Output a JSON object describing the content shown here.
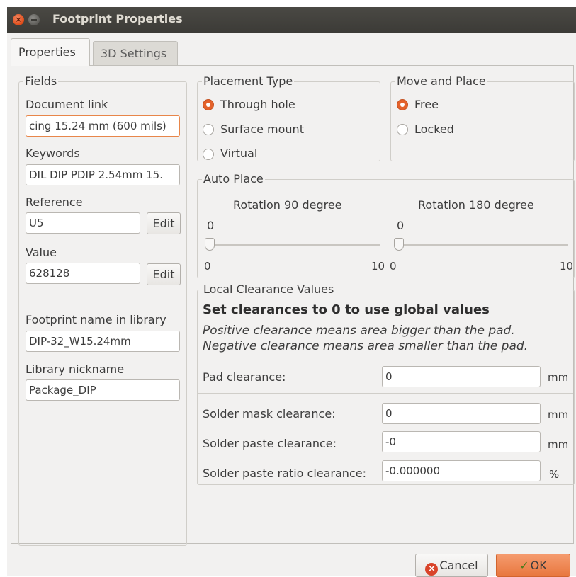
{
  "window": {
    "title": "Footprint Properties"
  },
  "tabs": [
    {
      "label": "Properties",
      "active": true
    },
    {
      "label": "3D Settings",
      "active": false
    }
  ],
  "fields": {
    "legend": "Fields",
    "document_link_label": "Document link",
    "document_link_value": "cing 15.24 mm (600 mils)",
    "keywords_label": "Keywords",
    "keywords_value": "DIL DIP PDIP 2.54mm 15.",
    "reference_label": "Reference",
    "reference_value": "U5",
    "reference_edit": "Edit",
    "value_label": "Value",
    "value_value": "628128",
    "value_edit": "Edit",
    "footprint_label": "Footprint name in library",
    "footprint_value": "DIP-32_W15.24mm",
    "nickname_label": "Library nickname",
    "nickname_value": "Package_DIP"
  },
  "placement": {
    "legend": "Placement Type",
    "options": [
      {
        "label": "Through hole",
        "checked": true
      },
      {
        "label": "Surface mount",
        "checked": false
      },
      {
        "label": "Virtual",
        "checked": false
      }
    ]
  },
  "move": {
    "legend": "Move and Place",
    "options": [
      {
        "label": "Free",
        "checked": true
      },
      {
        "label": "Locked",
        "checked": false
      }
    ]
  },
  "autoplace": {
    "legend": "Auto Place",
    "rot90": {
      "title": "Rotation 90 degree",
      "value": "0",
      "min": "0",
      "max": "10"
    },
    "rot180": {
      "title": "Rotation 180 degree",
      "value": "0",
      "min": "0",
      "max": "10"
    }
  },
  "clearance": {
    "legend": "Local Clearance Values",
    "heading": "Set clearances to 0 to use global values",
    "note1": "Positive clearance means area bigger than the pad.",
    "note2": "Negative clearance means area smaller than the pad.",
    "rows": [
      {
        "label": "Pad clearance:",
        "value": "0",
        "unit": "mm"
      },
      {
        "label": "Solder mask clearance:",
        "value": "0",
        "unit": "mm"
      },
      {
        "label": "Solder paste clearance:",
        "value": "-0",
        "unit": "mm"
      },
      {
        "label": "Solder paste ratio clearance:",
        "value": "-0.000000",
        "unit": "%"
      }
    ]
  },
  "buttons": {
    "cancel": "Cancel",
    "ok": "OK"
  },
  "colors": {
    "accent": "#e4622b",
    "titlebar": "#3c3b37",
    "ok": "#f08a55"
  }
}
